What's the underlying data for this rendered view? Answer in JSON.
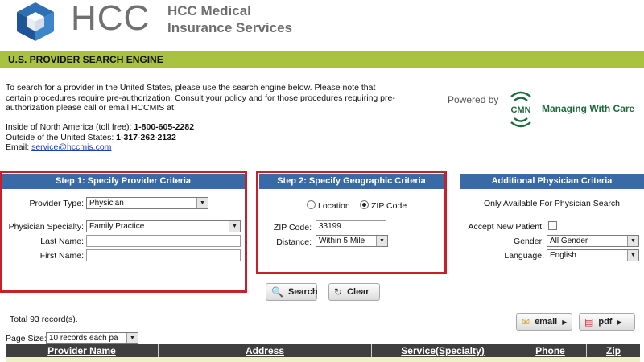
{
  "header": {
    "logo_text": "HCC",
    "company_name": "HCC Medical Insurance Services",
    "title_bar": "U.S. PROVIDER SEARCH ENGINE"
  },
  "intro": {
    "text": "To search for a provider in the United States, please use the search engine below. Please note that certain procedures require pre-authorization. Consult your policy and for those procedures requiring pre-authorization please call or email HCCMIS at:",
    "north_america_label": "Inside of North America (toll free): ",
    "north_america_phone": "1-800-605-2282",
    "outside_label": "Outside of the United States: ",
    "outside_phone": "1-317-262-2132",
    "email_label": "Email: ",
    "email": "service@hccmis.com"
  },
  "partner": {
    "powered_by": "Powered by",
    "logo_letters": "CMN",
    "tagline": "Managing With Care"
  },
  "step1": {
    "title": "Step 1: Specify Provider Criteria",
    "provider_type_label": "Provider Type:",
    "provider_type_value": "Physician",
    "specialty_label": "Physician Specialty:",
    "specialty_value": "Family Practice",
    "last_name_label": "Last Name:",
    "last_name_value": "",
    "first_name_label": "First Name:",
    "first_name_value": ""
  },
  "step2": {
    "title": "Step 2: Specify Geographic Criteria",
    "radio_location": "Location",
    "radio_zip": "ZIP Code",
    "selected": "zip",
    "zip_label": "ZIP Code:",
    "zip_value": "33199",
    "distance_label": "Distance:",
    "distance_value": "Within 5 Mile"
  },
  "additional": {
    "title": "Additional Physician Criteria",
    "note": "Only Available For Physician Search",
    "accept_label": "Accept New Patient:",
    "gender_label": "Gender:",
    "gender_value": "All Gender",
    "language_label": "Language:",
    "language_value": "English"
  },
  "actions": {
    "search": "Search",
    "clear": "Clear",
    "email": "email",
    "pdf": "pdf"
  },
  "results": {
    "total": "Total 93 record(s).",
    "page_size_label": "Page Size:",
    "page_size_value": "10 records each pa",
    "columns": [
      "Provider Name",
      "Address",
      "Service(Specialty)",
      "Phone",
      "Zip"
    ]
  },
  "colors": {
    "title_bar": "#a9c23f",
    "panel_header": "#3a6aa6",
    "highlight_border": "#c8202a",
    "grid_header": "#3f3f3f"
  }
}
